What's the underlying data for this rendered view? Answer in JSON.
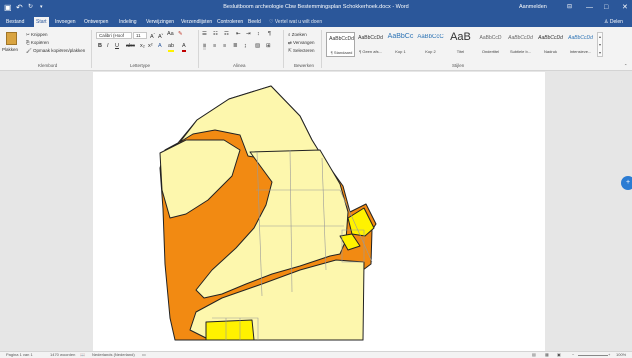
{
  "titlebar": {
    "save_icon": "save-icon",
    "undo_icon": "undo-icon",
    "redo_icon": "redo-icon",
    "title": "Besluitboom archeologie Cbw Bestemmingsplan Schokkerhoek.docx  -  Word",
    "signin": "Aanmelden",
    "ribbon_options_icon": "ribbon-display-icon",
    "minimize": "—",
    "maximize": "□",
    "close": "✕"
  },
  "tabs": [
    {
      "label": "Bestand"
    },
    {
      "label": "Start"
    },
    {
      "label": "Invoegen"
    },
    {
      "label": "Ontwerpen"
    },
    {
      "label": "Indeling"
    },
    {
      "label": "Verwijzingen"
    },
    {
      "label": "Verzendlijsten"
    },
    {
      "label": "Controleren"
    },
    {
      "label": "Beeld"
    }
  ],
  "tellme": "Vertel wat u wilt doen",
  "share": "Delen",
  "clipboard": {
    "paste": "Plakken",
    "cut": "Knippen",
    "copy": "Kopiëren",
    "format_painter": "Opmaak kopiëren/plakken",
    "group": "Klembord"
  },
  "font": {
    "name": "Calibri (Hoof",
    "size": "11",
    "group": "Lettertype"
  },
  "paragraph": {
    "group": "Alinea"
  },
  "editing": {
    "find": "Zoeken",
    "replace": "Vervangen",
    "select": "Selecteren",
    "group": "Bewerken"
  },
  "styles": {
    "group": "Stijlen",
    "items": [
      {
        "preview": "AaBbCcDd",
        "name": "¶ Standaard"
      },
      {
        "preview": "AaBbCcDd",
        "name": "¶ Geen afs..."
      },
      {
        "preview": "AaBbCc",
        "name": "Kop 1"
      },
      {
        "preview": "AaBbCcC",
        "name": "Kop 2"
      },
      {
        "preview": "AaB",
        "name": "Titel"
      },
      {
        "preview": "AaBbCcD",
        "name": "Ondertitel"
      },
      {
        "preview": "AaBbCcDd",
        "name": "Subtiele b..."
      },
      {
        "preview": "AaBbCcDd",
        "name": "Nadruk"
      },
      {
        "preview": "AaBbCcDd",
        "name": "Intensieve..."
      }
    ]
  },
  "colors": {
    "brand": "#2b579a",
    "orange": "#f28a12",
    "pale_yellow": "#fdf7ad",
    "bright_yellow": "#fff200"
  },
  "status": {
    "page": "Pagina 1 van 1",
    "words": "1470 woorden",
    "language": "Nederlands (Nederland)",
    "zoom": "100%"
  },
  "float_button_icon": "plus-icon"
}
